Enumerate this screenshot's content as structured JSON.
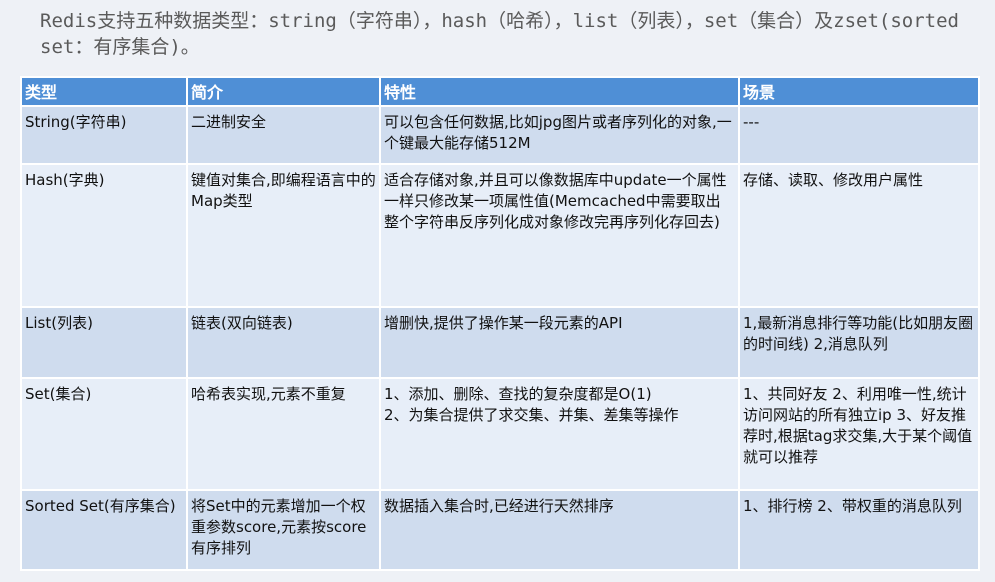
{
  "intro": "Redis支持五种数据类型：string（字符串），hash（哈希），list（列表），set（集合）及zset(sorted set：有序集合)。",
  "table": {
    "headers": [
      "类型",
      "简介",
      "特性",
      "场景"
    ],
    "rows": [
      {
        "type": "String(字符串)",
        "intro": "二进制安全",
        "feature": "可以包含任何数据,比如jpg图片或者序列化的对象,一个键最大能存储512M",
        "scene": "---"
      },
      {
        "type": "Hash(字典)",
        "intro": "键值对集合,即编程语言中的Map类型",
        "feature": "适合存储对象,并且可以像数据库中update一个属性一样只修改某一项属性值(Memcached中需要取出整个字符串反序列化成对象修改完再序列化存回去)",
        "scene": "存储、读取、修改用户属性"
      },
      {
        "type": "List(列表)",
        "intro": "链表(双向链表)",
        "feature": "增删快,提供了操作某一段元素的API",
        "scene": "1,最新消息排行等功能(比如朋友圈的时间线) 2,消息队列"
      },
      {
        "type": "Set(集合)",
        "intro": "哈希表实现,元素不重复",
        "feature": [
          "1、添加、删除、查找的复杂度都是O(1)",
          "2、为集合提供了求交集、并集、差集等操作"
        ],
        "scene": "1、共同好友 2、利用唯一性,统计访问网站的所有独立ip 3、好友推荐时,根据tag求交集,大于某个阈值就可以推荐"
      },
      {
        "type": "Sorted Set(有序集合)",
        "intro": "将Set中的元素增加一个权重参数score,元素按score有序排列",
        "feature": "数据插入集合时,已经进行天然排序",
        "scene": "1、排行榜 2、带权重的消息队列"
      }
    ]
  }
}
